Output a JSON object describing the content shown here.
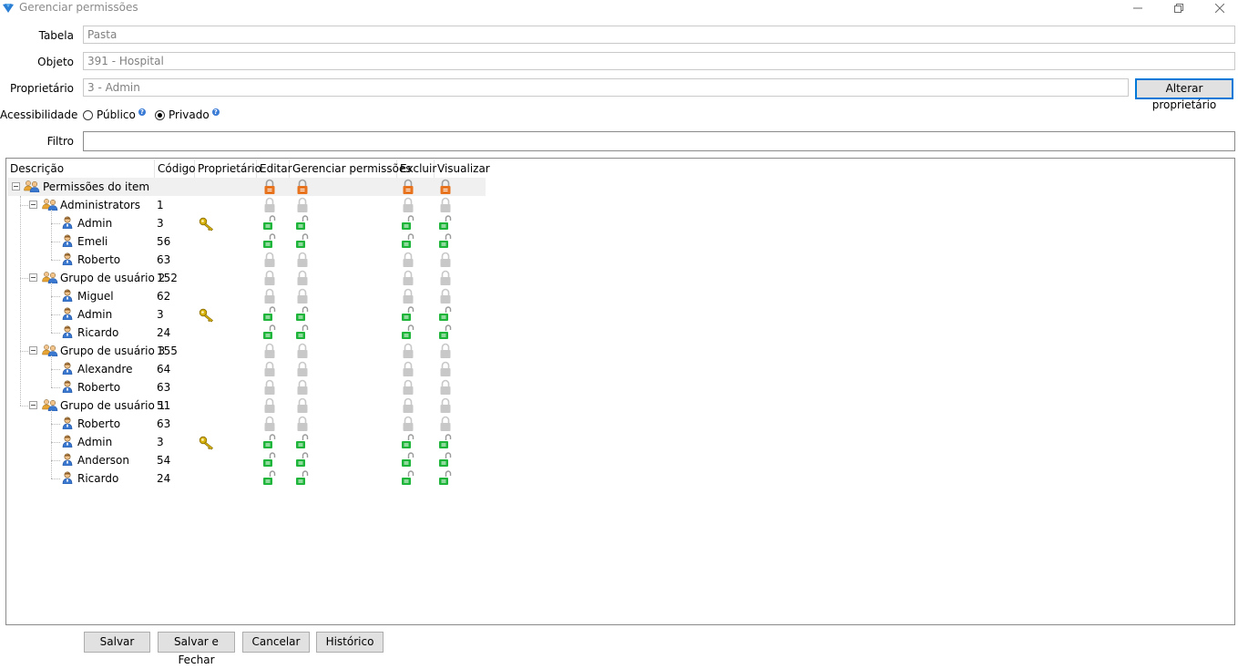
{
  "window": {
    "title": "Gerenciar permissões"
  },
  "form": {
    "tabela_label": "Tabela",
    "tabela_value": "Pasta",
    "objeto_label": "Objeto",
    "objeto_value": "391 - Hospital",
    "proprietario_label": "Proprietário",
    "proprietario_value": "3 - Admin",
    "alterar_button": "Alterar proprietário",
    "acessibilidade_label": "Acessibilidade",
    "publico_label": "Público",
    "privado_label": "Privado",
    "selected_accessibility": "Privado",
    "filtro_label": "Filtro",
    "filtro_value": ""
  },
  "grid": {
    "columns": [
      "Descrição",
      "Código",
      "Proprietário",
      "Editar",
      "Gerenciar permissões",
      "Excluir",
      "Visualizar"
    ],
    "rows": [
      {
        "level": 0,
        "type": "root",
        "desc": "Permissões do item",
        "code": "",
        "owner": false,
        "perm": "inherited"
      },
      {
        "level": 1,
        "type": "group",
        "desc": "Administrators",
        "code": "1",
        "owner": false,
        "perm": "none"
      },
      {
        "level": 2,
        "type": "user",
        "desc": "Admin",
        "code": "3",
        "owner": true,
        "perm": "granted"
      },
      {
        "level": 2,
        "type": "user",
        "desc": "Emeli",
        "code": "56",
        "owner": false,
        "perm": "granted"
      },
      {
        "level": 2,
        "type": "user",
        "desc": "Roberto",
        "code": "63",
        "owner": false,
        "perm": "none"
      },
      {
        "level": 1,
        "type": "group",
        "desc": "Grupo de usuário 2",
        "code": "152",
        "owner": false,
        "perm": "none"
      },
      {
        "level": 2,
        "type": "user",
        "desc": "Miguel",
        "code": "62",
        "owner": false,
        "perm": "none"
      },
      {
        "level": 2,
        "type": "user",
        "desc": "Admin",
        "code": "3",
        "owner": true,
        "perm": "granted"
      },
      {
        "level": 2,
        "type": "user",
        "desc": "Ricardo",
        "code": "24",
        "owner": false,
        "perm": "granted"
      },
      {
        "level": 1,
        "type": "group",
        "desc": "Grupo de usuário 3",
        "code": "155",
        "owner": false,
        "perm": "none"
      },
      {
        "level": 2,
        "type": "user",
        "desc": "Alexandre",
        "code": "64",
        "owner": false,
        "perm": "none"
      },
      {
        "level": 2,
        "type": "user",
        "desc": "Roberto",
        "code": "63",
        "owner": false,
        "perm": "none"
      },
      {
        "level": 1,
        "type": "group",
        "desc": "Grupo de usuário 1",
        "code": "51",
        "owner": false,
        "perm": "none"
      },
      {
        "level": 2,
        "type": "user",
        "desc": "Roberto",
        "code": "63",
        "owner": false,
        "perm": "none"
      },
      {
        "level": 2,
        "type": "user",
        "desc": "Admin",
        "code": "3",
        "owner": true,
        "perm": "granted"
      },
      {
        "level": 2,
        "type": "user",
        "desc": "Anderson",
        "code": "54",
        "owner": false,
        "perm": "granted"
      },
      {
        "level": 2,
        "type": "user",
        "desc": "Ricardo",
        "code": "24",
        "owner": false,
        "perm": "granted"
      }
    ]
  },
  "buttons": {
    "salvar": "Salvar",
    "salvar_fechar": "Salvar e Fechar",
    "cancelar": "Cancelar",
    "historico": "Histórico"
  },
  "icons": {
    "app": "app-logo-icon",
    "group": "user-group-icon",
    "user": "user-icon",
    "owner": "key-icon",
    "lock_inherited": "lock-orange-icon",
    "lock_none": "lock-gray-icon",
    "lock_granted": "lock-green-icon"
  },
  "colors": {
    "lock_inherited": "#e8731f",
    "lock_none": "#c8c8c8",
    "lock_granted": "#1fb53a",
    "focus_border": "#0078d7",
    "key": "#d6b20a"
  }
}
